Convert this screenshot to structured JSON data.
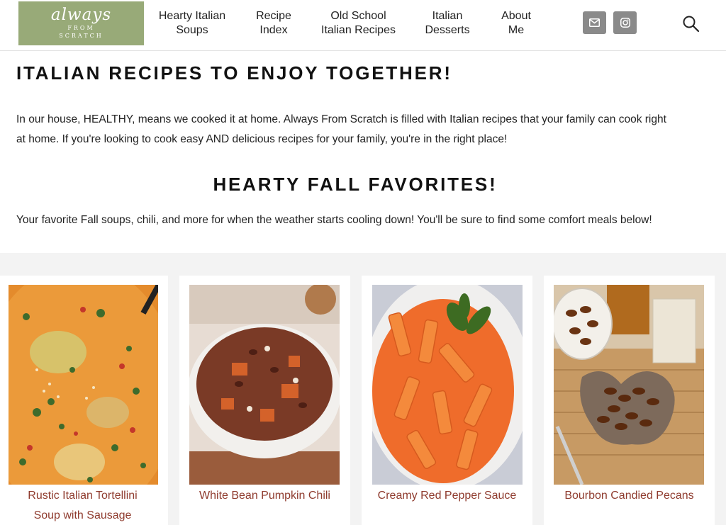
{
  "logo": {
    "script": "always",
    "line1": "FROM",
    "line2": "SCRATCH"
  },
  "nav": [
    {
      "line1": "Hearty Italian",
      "line2": "Soups"
    },
    {
      "line1": "Recipe",
      "line2": "Index"
    },
    {
      "line1": "Old School",
      "line2": "Italian Recipes"
    },
    {
      "line1": "Italian",
      "line2": "Desserts"
    },
    {
      "line1": "About",
      "line2": "Me"
    }
  ],
  "social_icons": [
    "email-icon",
    "instagram-icon"
  ],
  "intro": {
    "heading": "ITALIAN RECIPES TO ENJOY TOGETHER!",
    "body_line1": "In our house, HEALTHY, means we cooked it at home. Always From Scratch is filled with Italian recipes that your family can cook right",
    "body_line2": "at home. If you're looking to cook easy AND delicious recipes for your family, you're in the right place!"
  },
  "favorites": {
    "heading": "HEARTY FALL FAVORITES!",
    "subtitle": "Your favorite Fall soups, chili, and more for when the weather starts cooling down! You'll be sure to find some comfort meals below!"
  },
  "cards": [
    {
      "title_line1": "Rustic Italian Tortellini",
      "title_line2": "Soup with Sausage"
    },
    {
      "title_line1": "White Bean Pumpkin Chili",
      "title_line2": ""
    },
    {
      "title_line1": "Creamy Red Pepper Sauce",
      "title_line2": ""
    },
    {
      "title_line1": "Bourbon Candied Pecans",
      "title_line2": ""
    }
  ],
  "colors": {
    "logo_bg": "#98aa78",
    "link": "#8f3b2e",
    "social_bg": "#8a8a8a",
    "band_bg": "#f3f3f3"
  }
}
